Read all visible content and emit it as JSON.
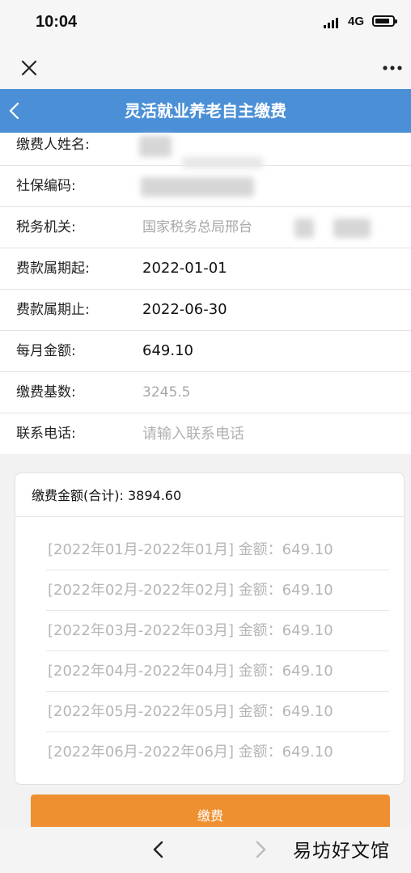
{
  "status": {
    "time": "10:04",
    "network": "4G"
  },
  "header": {
    "title": "灵活就业养老自主缴费"
  },
  "form": {
    "rows": [
      {
        "label": "缴费人姓名:",
        "value": ""
      },
      {
        "label": "社保编码:",
        "value": ""
      },
      {
        "label": "税务机关:",
        "value": "国家税务总局邢台"
      },
      {
        "label": "费款属期起:",
        "value": "2022-01-01"
      },
      {
        "label": "费款属期止:",
        "value": "2022-06-30"
      },
      {
        "label": "每月金额:",
        "value": "649.10"
      },
      {
        "label": "缴费基数:",
        "value": "3245.5"
      },
      {
        "label": "联系电话:",
        "placeholder": "请输入联系电话",
        "value": ""
      }
    ]
  },
  "summary": {
    "total_label": "缴费金额(合计):",
    "total_value": "3894.60",
    "items": [
      "[2022年01月-2022年01月] 金额：649.10",
      "[2022年02月-2022年02月] 金额：649.10",
      "[2022年03月-2022年03月] 金额：649.10",
      "[2022年04月-2022年04月] 金额：649.10",
      "[2022年05月-2022年05月] 金额：649.10",
      "[2022年06月-2022年06月] 金额：649.10"
    ]
  },
  "actions": {
    "pay_label": "缴费"
  },
  "footer": {
    "watermark": "易坊好文馆"
  },
  "colors": {
    "header": "#4b90d6",
    "pay_button": "#ef9030"
  }
}
